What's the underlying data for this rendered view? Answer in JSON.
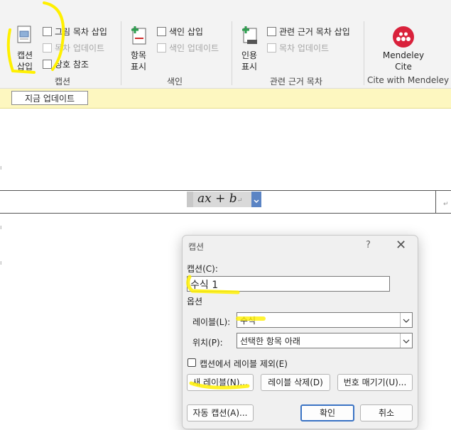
{
  "ribbon": {
    "insert_caption": {
      "line1": "캡션",
      "line2": "삽입"
    },
    "insert_tof": "그림 목차 삽입",
    "update_table": "목차 업데이트",
    "cross_reference": "상호 참조",
    "captions_group": "캡션",
    "mark_entry": {
      "line1": "항목",
      "line2": "표시"
    },
    "insert_index": "색인 삽입",
    "update_index": "색인 업데이트",
    "index_group": "색인",
    "mark_citation": {
      "line1": "인용",
      "line2": "표시"
    },
    "insert_toa": "관련 근거 목차 삽입",
    "update_toa": "목차 업데이트",
    "toa_group": "관련 근거 목차",
    "mendeley": {
      "line1": "Mendeley",
      "line2": "Cite"
    },
    "mendeley_group": "Cite with Mendeley"
  },
  "message_bar": {
    "update_now": "지금 업데이트"
  },
  "document": {
    "equation_a": "ax",
    "equation_op": " + ",
    "equation_b": "b"
  },
  "dialog": {
    "title": "캡션",
    "help": "?",
    "caption_label": "캡션(C):",
    "caption_value": "수식  1",
    "options_label": "옵션",
    "label_label": "레이블(L):",
    "label_value": "수식",
    "position_label": "위치(P):",
    "position_value": "선택한 항목 아래",
    "exclude_label": "캡션에서 레이블 제외(E)",
    "new_label_btn": "새 레이블(N)...",
    "delete_label_btn": "레이블 삭제(D)",
    "numbering_btn": "번호 매기기(U)...",
    "autocaption_btn": "자동 캡션(A)...",
    "ok_btn": "확인",
    "cancel_btn": "취소"
  },
  "colors": {
    "highlight": "#fff000",
    "mendeley": "#d9213b",
    "accent": "#3a73c4"
  }
}
